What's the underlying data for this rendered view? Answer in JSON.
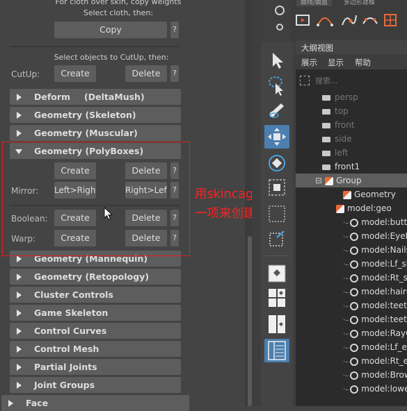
{
  "left_panel": {
    "cloth_hint_1": "For cloth over skin, copy weights",
    "cloth_hint_2": "Select cloth, then:",
    "copy_button": "Copy",
    "help": "?",
    "cutup_hint": "Select objects to CutUp, then:",
    "cutup_label": "CutUp:",
    "create_label": "Create",
    "delete_label": "Delete",
    "sections_top": [
      "Deform",
      "Geometry (Skeleton)",
      "Geometry (Muscular)"
    ],
    "deform_sub": "(DeltaMush)",
    "polyboxes": {
      "title": "Geometry (PolyBoxes)",
      "mirror_label": "Mirror:",
      "left_right": "Left>Right",
      "right_left": "Right>Left",
      "boolean_label": "Boolean:",
      "warp_label": "Warp:"
    },
    "sections_bottom": [
      "Geometry (Mannequin)",
      "Geometry (Retopology)",
      "Cluster Controls",
      "Game Skeleton",
      "Control Curves",
      "Control Mesh",
      "Partial Joints",
      "Joint Groups"
    ],
    "face_label": "Face"
  },
  "annotation": {
    "line1": "用skincage创建的就用这",
    "line2": "一项来创建代理模型"
  },
  "top_tabs": [
    "曲线/曲面",
    "多边形建模"
  ],
  "outliner": {
    "title": "大纲视图",
    "menu": [
      "展示",
      "显示",
      "帮助"
    ],
    "search_placeholder": "搜索...",
    "items": [
      {
        "label": "persp",
        "type": "camera",
        "dim": true
      },
      {
        "label": "top",
        "type": "camera",
        "dim": true
      },
      {
        "label": "front",
        "type": "camera",
        "dim": true
      },
      {
        "label": "side",
        "type": "camera",
        "dim": true
      },
      {
        "label": "left",
        "type": "camera",
        "dim": true
      },
      {
        "label": "front1",
        "type": "camera",
        "dim": false
      },
      {
        "label": "Group",
        "type": "group",
        "dim": false
      },
      {
        "label": "Geometry",
        "type": "group",
        "dim": false
      },
      {
        "label": "model:geo",
        "type": "group",
        "dim": false
      },
      {
        "label": "model:butto",
        "type": "mesh",
        "dim": false
      },
      {
        "label": "model:EyeLa",
        "type": "mesh",
        "dim": false
      },
      {
        "label": "model:Nails",
        "type": "mesh",
        "dim": false
      },
      {
        "label": "model:Lf_sh",
        "type": "mesh",
        "dim": false
      },
      {
        "label": "model:Rt_sh",
        "type": "mesh",
        "dim": false
      },
      {
        "label": "model:hairG",
        "type": "mesh",
        "dim": false
      },
      {
        "label": "model:teeth",
        "type": "mesh",
        "dim": false
      },
      {
        "label": "model:teeth",
        "type": "mesh",
        "dim": false
      },
      {
        "label": "model:RayG",
        "type": "mesh",
        "dim": false
      },
      {
        "label": "model:Lf_ey",
        "type": "mesh",
        "dim": false
      },
      {
        "label": "model:Rt_ey",
        "type": "mesh",
        "dim": false
      },
      {
        "label": "model:Brow",
        "type": "mesh",
        "dim": false
      },
      {
        "label": "model:lowe",
        "type": "mesh",
        "dim": false
      }
    ]
  },
  "colors": {
    "accent": "#4a7fb0",
    "annotation": "#ff2020",
    "panel": "#444444"
  }
}
